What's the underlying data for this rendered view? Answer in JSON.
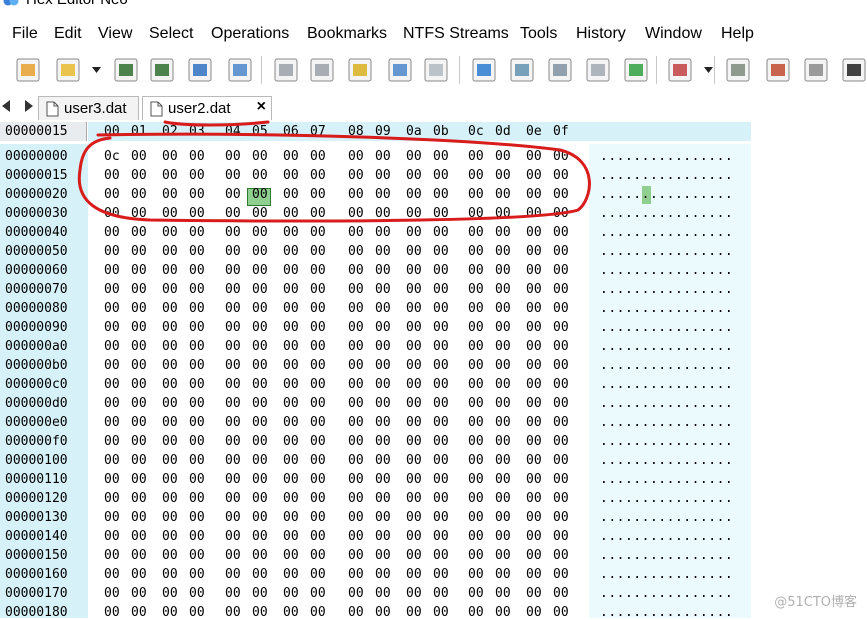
{
  "window": {
    "title": "Hex Editor Neo"
  },
  "menu": [
    "File",
    "Edit",
    "View",
    "Select",
    "Operations",
    "Bookmarks",
    "NTFS Streams",
    "Tools",
    "History",
    "Window",
    "Help"
  ],
  "toolbar": {
    "icons": [
      "new-file-icon",
      "open-folder-icon",
      "save-icon",
      "save-all-icon",
      "save-as-icon",
      "print-icon",
      "undo-icon",
      "redo-icon",
      "copy-hex-icon",
      "paste-hex-icon",
      "paste-special-icon",
      "goto-icon",
      "find-icon",
      "find-next-icon",
      "find-previous-icon",
      "select-range-icon",
      "bit-display-icon",
      "fill-icon",
      "checksum-icon",
      "encoding-icon",
      "binary-view-icon"
    ]
  },
  "tabs": [
    {
      "label": "user3.dat",
      "active": false
    },
    {
      "label": "user2.dat",
      "active": true,
      "close": "×"
    }
  ],
  "grid": {
    "header_offset": "00000015",
    "columns": [
      "00",
      "01",
      "02",
      "03",
      "04",
      "05",
      "06",
      "07",
      "08",
      "09",
      "0a",
      "0b",
      "0c",
      "0d",
      "0e",
      "0f"
    ],
    "addresses": [
      "00000000",
      "00000015",
      "00000020",
      "00000030",
      "00000040",
      "00000050",
      "00000060",
      "00000070",
      "00000080",
      "00000090",
      "000000a0",
      "000000b0",
      "000000c0",
      "000000d0",
      "000000e0",
      "000000f0",
      "00000100",
      "00000110",
      "00000120",
      "00000130",
      "00000140",
      "00000150",
      "00000160",
      "00000170",
      "00000180"
    ],
    "first_byte": "0c",
    "fill_byte": "00",
    "ascii_row": "................",
    "cursor": {
      "row": 1,
      "col": 5,
      "value": "00"
    }
  },
  "colors": {
    "header_bg": "#d6f2f8",
    "ascii_bg": "#ebfbfd",
    "cursor": "#8fcf8f",
    "annotation": "#d81c1c"
  },
  "watermark": "@51CTO博客"
}
